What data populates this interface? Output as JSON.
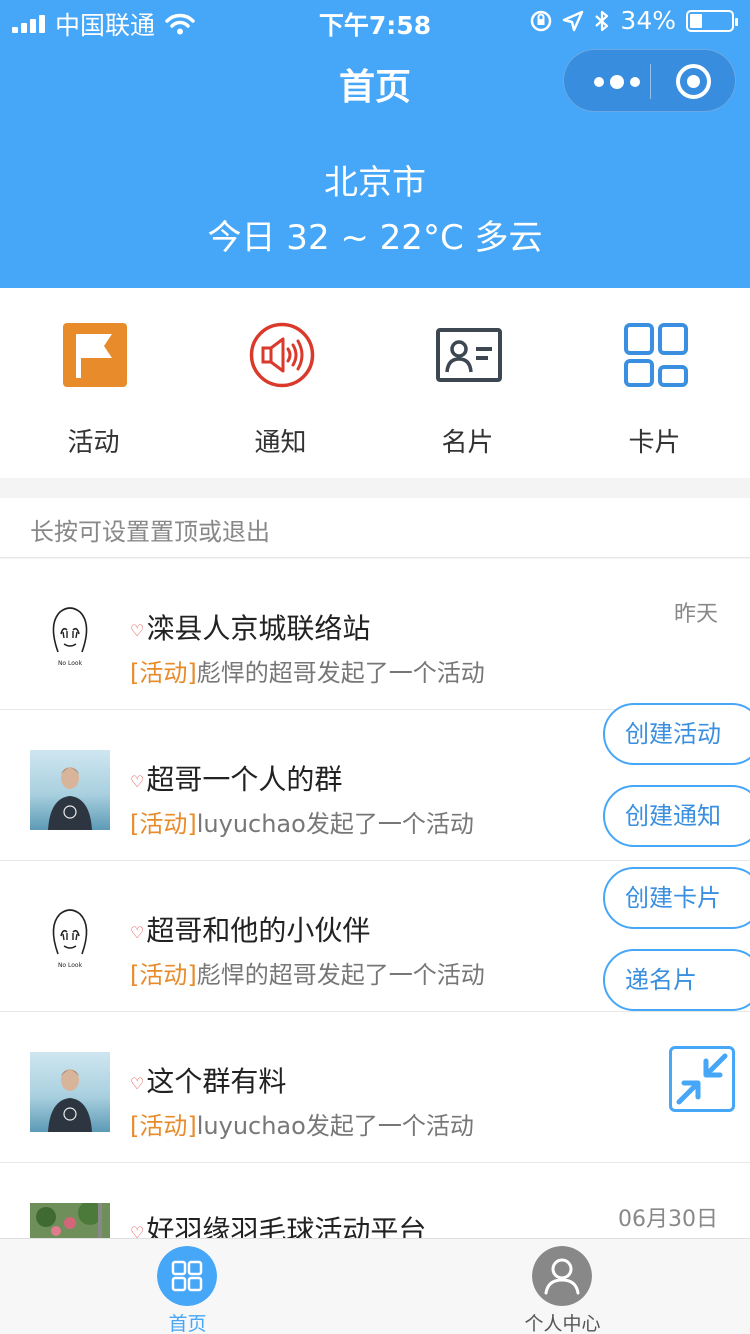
{
  "status_bar": {
    "carrier": "中国联通",
    "time": "下午7:58",
    "battery": "34%"
  },
  "nav": {
    "title": "首页"
  },
  "weather": {
    "city": "北京市",
    "summary": "今日 32 ~ 22°C 多云"
  },
  "quick_actions": [
    {
      "label": "活动",
      "icon": "flag-icon"
    },
    {
      "label": "通知",
      "icon": "speaker-icon"
    },
    {
      "label": "名片",
      "icon": "contact-card-icon"
    },
    {
      "label": "卡片",
      "icon": "grid-icon"
    }
  ],
  "hint": "长按可设置置顶或退出",
  "groups": [
    {
      "name": "滦县人京城联络站",
      "tag": "[活动]",
      "message": "彪悍的超哥发起了一个活动",
      "time": "昨天",
      "avatar": "no-look-avatar"
    },
    {
      "name": "超哥一个人的群",
      "tag": "[活动]",
      "message": "luyuchao发起了一个活动",
      "time": "",
      "avatar": "photo-avatar"
    },
    {
      "name": "超哥和他的小伙伴",
      "tag": "[活动]",
      "message": "彪悍的超哥发起了一个活动",
      "time": "",
      "avatar": "no-look-avatar"
    },
    {
      "name": "这个群有料",
      "tag": "[活动]",
      "message": "luyuchao发起了一个活动",
      "time": "",
      "avatar": "photo-avatar"
    },
    {
      "name": "好羽缘羽毛球活动平台",
      "tag": "",
      "message": "",
      "time": "06月30日",
      "avatar": "garden-avatar"
    }
  ],
  "float_menu": {
    "create_activity": "创建活动",
    "create_notice": "创建通知",
    "create_card": "创建卡片",
    "send_card": "递名片"
  },
  "no_look_text": "No Look",
  "tabs": [
    {
      "label": "首页",
      "active": true
    },
    {
      "label": "个人中心",
      "active": false
    }
  ],
  "colors": {
    "primary": "#46a6f7",
    "accent_orange": "#e78b2b",
    "notify_red": "#d93a2b",
    "card_dark": "#3d4752"
  }
}
